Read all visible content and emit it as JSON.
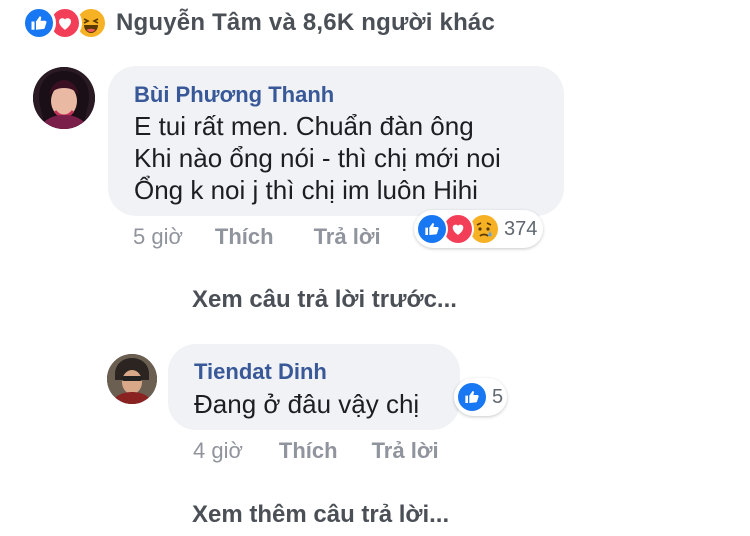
{
  "post_reactions": {
    "types": [
      "like",
      "love",
      "haha"
    ],
    "summary": "Nguyễn Tâm và 8,6K người khác"
  },
  "comments": [
    {
      "author": "Bùi Phương Thanh",
      "lines": [
        "E tui rất men. Chuẩn đàn ông",
        "Khi nào ổng nói - thì chị mới noi",
        "Ổng k noi j thì chị im luôn Hihi"
      ],
      "time": "5 giờ",
      "like_label": "Thích",
      "reply_label": "Trả lời",
      "reactions": {
        "types": [
          "like",
          "love",
          "sad"
        ],
        "count": "374"
      }
    },
    {
      "author": "Tiendat Dinh",
      "lines": [
        "Đang ở đâu vậy chị"
      ],
      "time": "4 giờ",
      "like_label": "Thích",
      "reply_label": "Trả lời",
      "reactions": {
        "types": [
          "like"
        ],
        "count": "5"
      }
    }
  ],
  "view_previous_replies": "Xem câu trả lời trước...",
  "view_more_replies": "Xem thêm câu trả lời...",
  "colors": {
    "like": "#1877f2",
    "love": "#f33e58",
    "haha": "#f7b125",
    "author": "#385898",
    "bubble": "#f0f2f5"
  }
}
